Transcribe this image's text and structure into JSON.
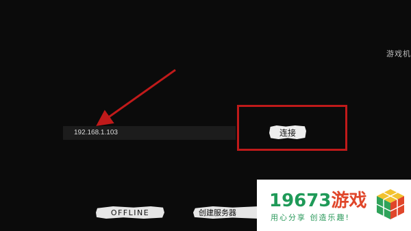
{
  "header": {
    "top_right_label": "游戏机"
  },
  "connection": {
    "ip_value": "192.168.1.103",
    "connect_label": "连接"
  },
  "footer": {
    "offline_label": "OFFLINE",
    "create_server_label": "创建服务器"
  },
  "annotation": {
    "color": "#c01a1a"
  },
  "watermark": {
    "title_digits": "19673",
    "title_text": "游戏",
    "subtitle": "用心分享 创造乐趣!",
    "brand_green": "#1f9a58",
    "brand_red": "#e0462a",
    "logo_icon": "colored-cube-icon"
  }
}
